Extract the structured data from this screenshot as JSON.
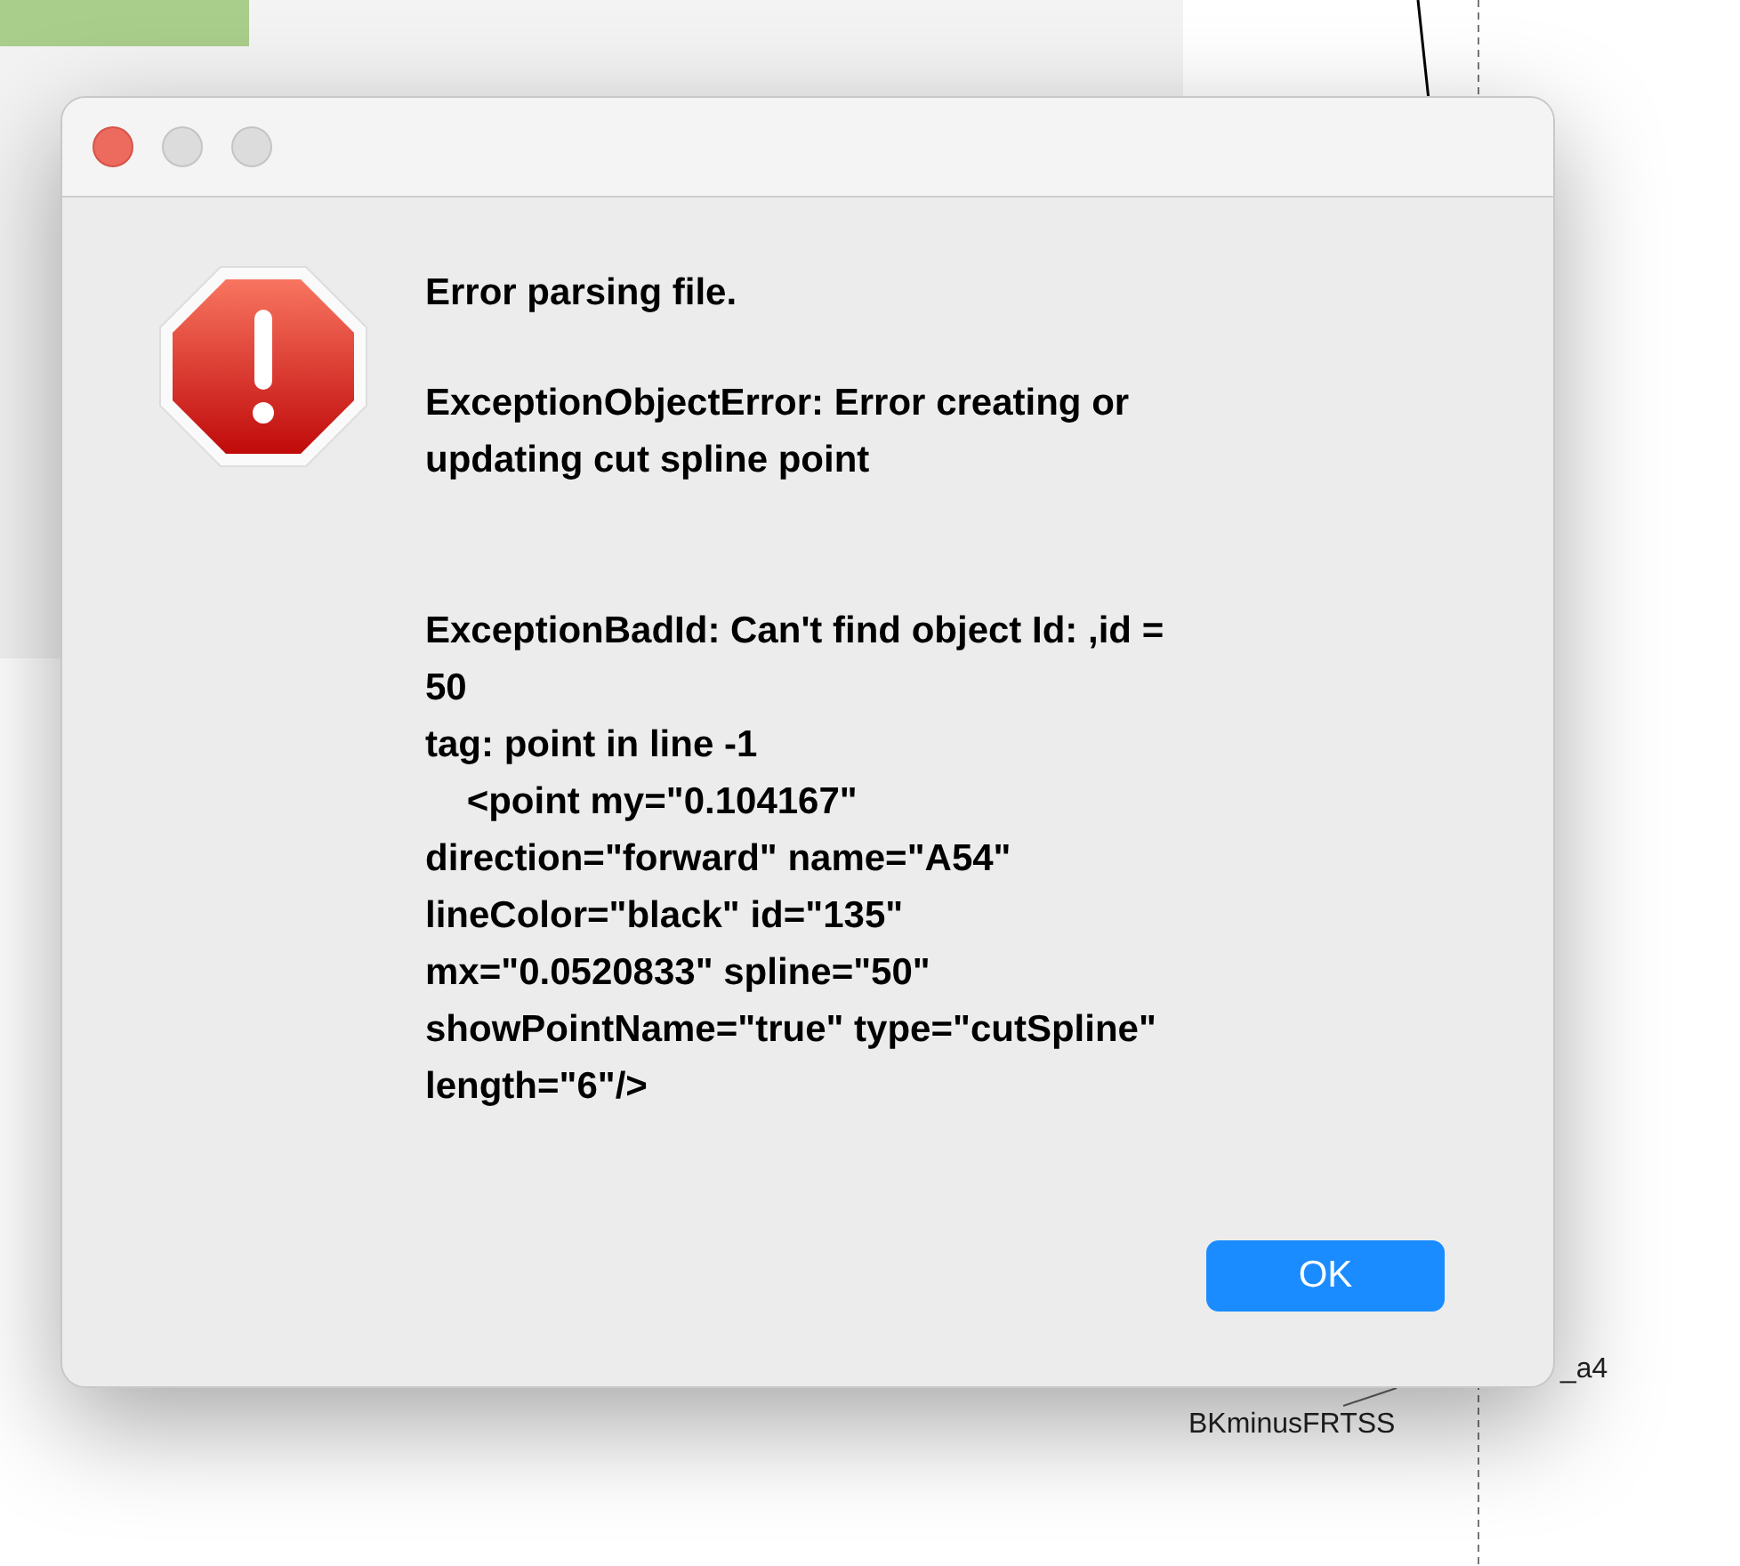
{
  "background": {
    "labels": [
      {
        "text": "_a4"
      },
      {
        "text": "BKminusFRTSS"
      }
    ]
  },
  "dialog": {
    "paragraphs": [
      "Error parsing file.",
      "ExceptionObjectError: Error creating or\nupdating cut spline point",
      "ExceptionBadId: Can't find object Id: ,id =\n50\ntag: point in line -1\n    <point my=\"0.104167\"\ndirection=\"forward\" name=\"A54\"\nlineColor=\"black\" id=\"135\"\nmx=\"0.0520833\" spline=\"50\"\nshowPointName=\"true\" type=\"cutSpline\"\nlength=\"6\"/>"
    ],
    "buttons": [
      {
        "label": "OK",
        "default": true
      }
    ]
  }
}
